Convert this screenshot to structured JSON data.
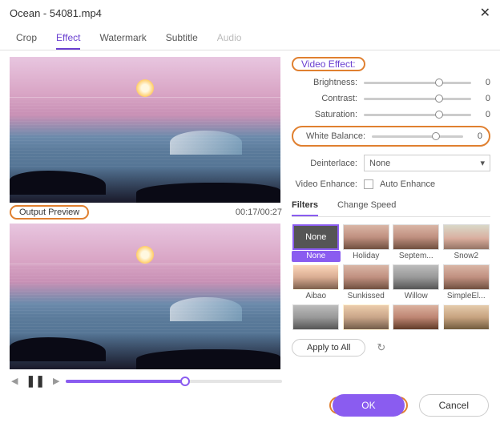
{
  "title": "Ocean - 54081.mp4",
  "tabs": [
    "Crop",
    "Effect",
    "Watermark",
    "Subtitle",
    "Audio"
  ],
  "section_label": "Video Effect:",
  "sliders": {
    "brightness": {
      "label": "Brightness:",
      "value": 0,
      "pos": 70
    },
    "contrast": {
      "label": "Contrast:",
      "value": 0,
      "pos": 70
    },
    "saturation": {
      "label": "Saturation:",
      "value": 0,
      "pos": 70
    },
    "white_balance": {
      "label": "White Balance:",
      "value": 0,
      "pos": 70
    }
  },
  "deinterlace": {
    "label": "Deinterlace:",
    "value": "None"
  },
  "enhance": {
    "label": "Video Enhance:",
    "checkbox_label": "Auto Enhance"
  },
  "subtabs": [
    "Filters",
    "Change Speed"
  ],
  "filters": {
    "none_text": "None",
    "items": [
      "None",
      "Holiday",
      "Septem...",
      "Snow2",
      "Aibao",
      "Sunkissed",
      "Willow",
      "SimpleEl..."
    ]
  },
  "apply_all": "Apply to All",
  "output_preview": "Output Preview",
  "time": "00:17/00:27",
  "ok": "OK",
  "cancel": "Cancel"
}
